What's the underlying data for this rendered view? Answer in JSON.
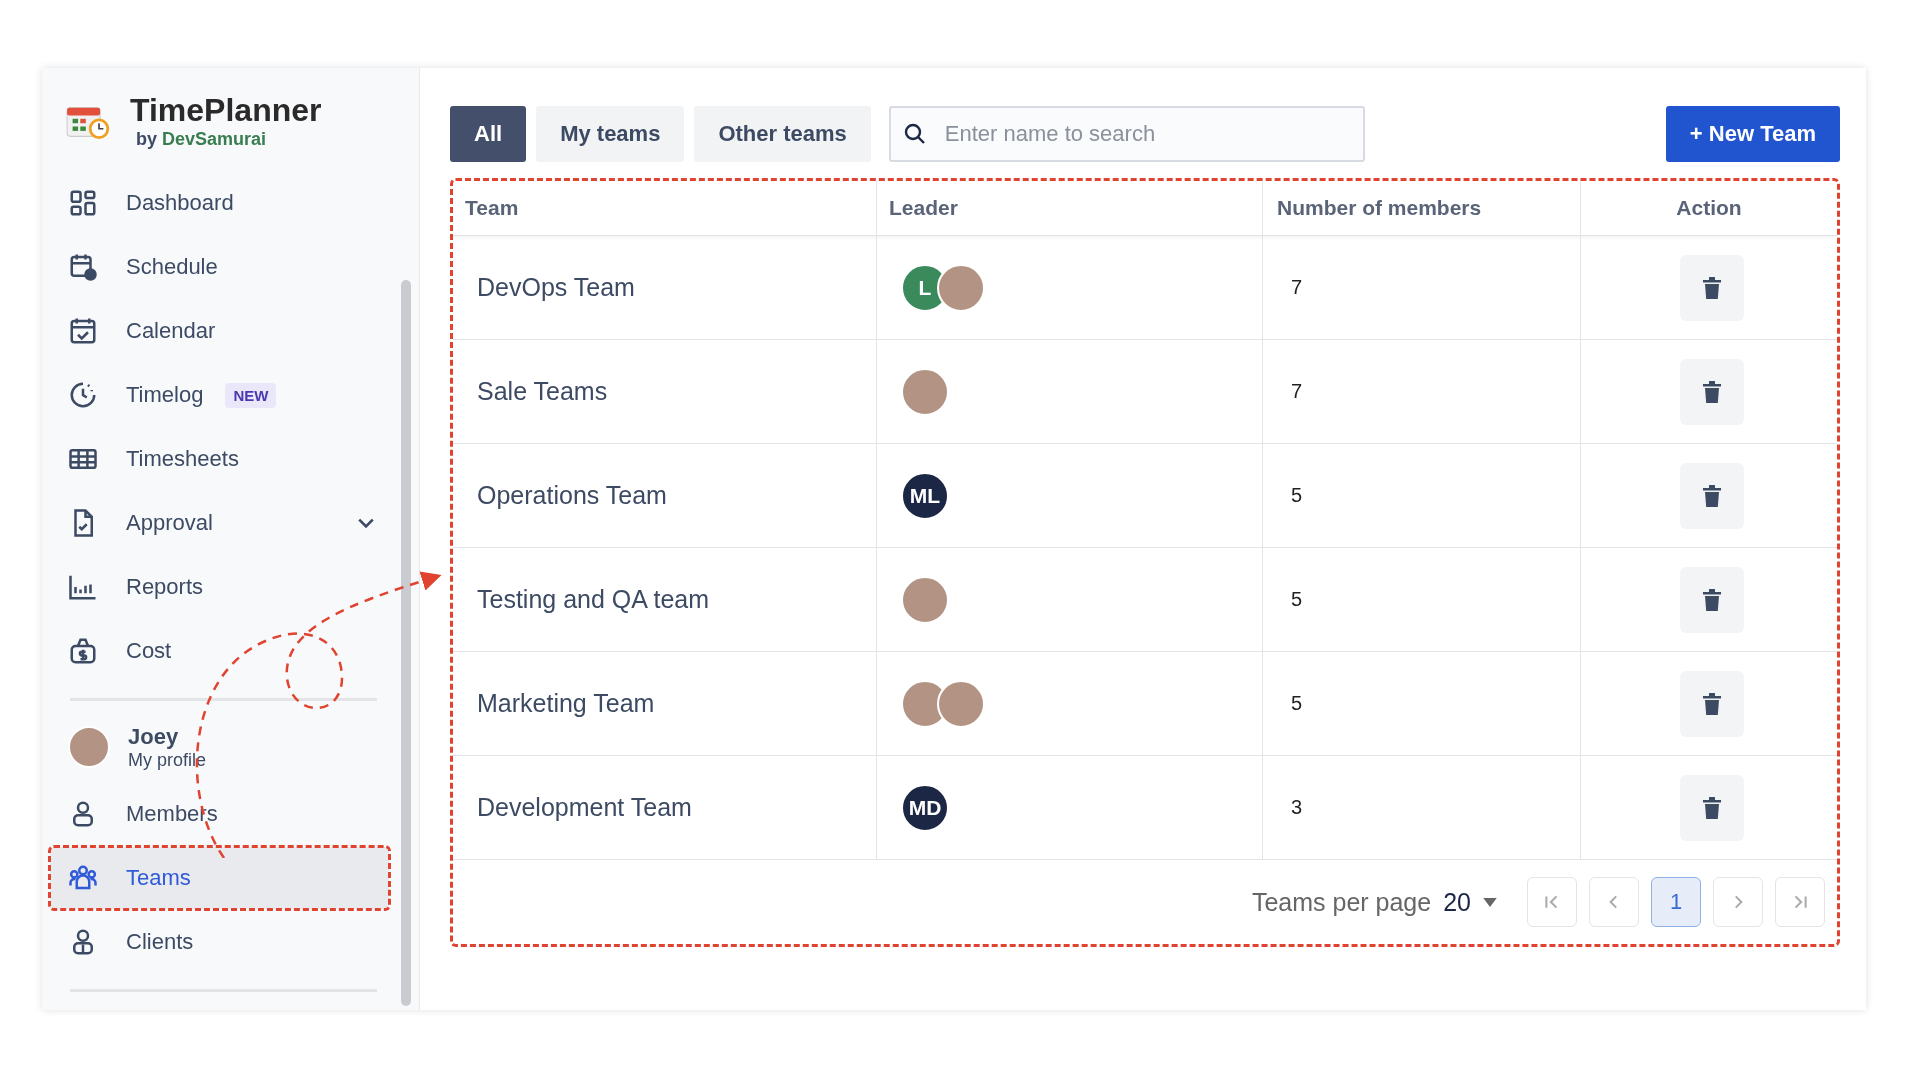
{
  "app": {
    "name": "TimePlanner",
    "by": "by",
    "vendor": "DevSamurai"
  },
  "nav": [
    {
      "label": "Dashboard",
      "selected": false
    },
    {
      "label": "Schedule",
      "selected": false
    },
    {
      "label": "Calendar",
      "selected": false
    },
    {
      "label": "Timelog",
      "badge": "NEW",
      "selected": false
    },
    {
      "label": "Timesheets",
      "selected": false
    },
    {
      "label": "Approval",
      "expandable": true,
      "selected": false
    },
    {
      "label": "Reports",
      "selected": false
    },
    {
      "label": "Cost",
      "selected": false
    }
  ],
  "profile": {
    "name": "Joey",
    "subtitle": "My profile"
  },
  "nav_bottom": [
    {
      "label": "Members",
      "selected": false
    },
    {
      "label": "Teams",
      "selected": true
    },
    {
      "label": "Clients",
      "selected": false
    }
  ],
  "tabs": [
    {
      "label": "All",
      "selected": true
    },
    {
      "label": "My teams",
      "selected": false
    },
    {
      "label": "Other teams",
      "selected": false
    }
  ],
  "search": {
    "placeholder": "Enter name to search"
  },
  "new_button": "+ New Team",
  "table": {
    "columns": [
      "Team",
      "Leader",
      "Number of members",
      "Action"
    ],
    "rows": [
      {
        "team": "DevOps Team",
        "leaders": [
          {
            "kind": "initials",
            "text": "L",
            "color": "#3b8a5c"
          },
          {
            "kind": "photo"
          }
        ],
        "members": "7"
      },
      {
        "team": "Sale Teams",
        "leaders": [
          {
            "kind": "photo"
          }
        ],
        "members": "7"
      },
      {
        "team": "Operations Team",
        "leaders": [
          {
            "kind": "initials",
            "text": "ML",
            "color": "#1c2745"
          }
        ],
        "members": "5"
      },
      {
        "team": "Testing and QA team",
        "leaders": [
          {
            "kind": "photo"
          }
        ],
        "members": "5"
      },
      {
        "team": "Marketing Team",
        "leaders": [
          {
            "kind": "photo"
          },
          {
            "kind": "photo"
          }
        ],
        "members": "5"
      },
      {
        "team": "Development Team",
        "leaders": [
          {
            "kind": "initials",
            "text": "MD",
            "color": "#1c2745"
          }
        ],
        "members": "3"
      }
    ]
  },
  "pagination": {
    "label": "Teams per page",
    "per_page": "20",
    "pages": [
      {
        "label": "1",
        "selected": true
      }
    ]
  }
}
